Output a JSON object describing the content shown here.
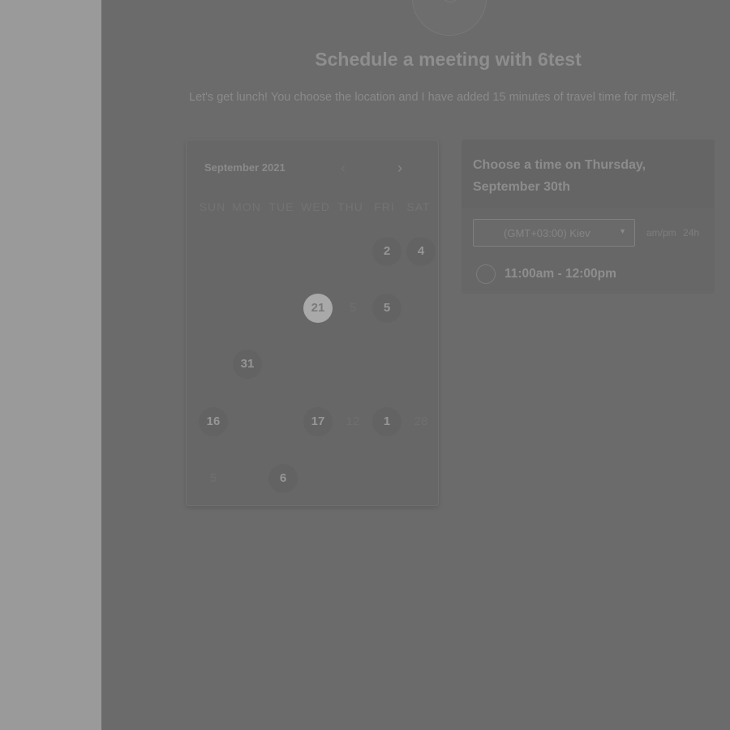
{
  "page": {
    "title": "Schedule a meeting with 6test",
    "description": "Let's get lunch! You choose the location and I have added 15 minutes of travel time for myself."
  },
  "calendar": {
    "month_label": "September 2021",
    "prev_icon": "chevron-left-icon",
    "next_icon": "chevron-right-icon",
    "weekdays": [
      "SUN",
      "MON",
      "TUE",
      "WED",
      "THU",
      "FRI",
      "SAT"
    ],
    "days": {
      "r1_fri": "2",
      "r1_sat": "4",
      "r2_wed": "21",
      "r2_thu": "5",
      "r2_fri": "5",
      "r3_mon": "31",
      "r4_sun": "16",
      "r4_wed": "17",
      "r4_thu": "12",
      "r4_fri": "1",
      "r4_sat": "28",
      "r5_sun": "5",
      "r5_tue": "6"
    },
    "selected_day": "21"
  },
  "times": {
    "header": "Choose a time on Thursday, September 30th",
    "timezone": "(GMT+03:00) Kiev",
    "format_ampm": "am/pm",
    "format_24h": "24h",
    "slots": [
      {
        "label": "11:00am - 12:00pm"
      }
    ]
  }
}
